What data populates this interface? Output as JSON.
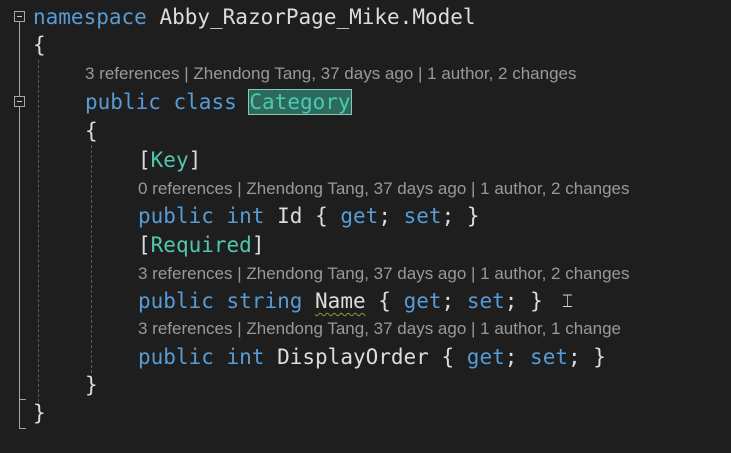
{
  "code": {
    "ns_keyword": "namespace",
    "ns_name": "Abby_RazorPage_Mike.Model",
    "open_brace_ns": "{",
    "close_brace_ns": "}",
    "class_modifier": "public",
    "class_keyword": "class",
    "class_name": "Category",
    "open_brace_class": "{",
    "close_brace_class": "}",
    "attr_key_open": "[",
    "attr_key": "Key",
    "attr_key_close": "]",
    "attr_required_open": "[",
    "attr_required": "Required",
    "attr_required_close": "]",
    "prop_id": {
      "modifier": "public",
      "type": "int",
      "name": "Id",
      "open": "{",
      "get": "get",
      "semi1": ";",
      "set": "set",
      "semi2": ";",
      "close": "}"
    },
    "prop_name": {
      "modifier": "public",
      "type": "string",
      "name": "Name",
      "open": "{",
      "get": "get",
      "semi1": ";",
      "set": "set",
      "semi2": ";",
      "close": "}"
    },
    "prop_display": {
      "modifier": "public",
      "type": "int",
      "name": "DisplayOrder",
      "open": "{",
      "get": "get",
      "semi1": ";",
      "set": "set",
      "semi2": ";",
      "close": "}"
    }
  },
  "codelens": {
    "class": "3 references | Zhendong Tang, 37 days ago | 1 author, 2 changes",
    "id": "0 references | Zhendong Tang, 37 days ago | 1 author, 2 changes",
    "name": "3 references | Zhendong Tang, 37 days ago | 1 author, 2 changes",
    "display_order": "3 references | Zhendong Tang, 37 days ago | 1 author, 1 change"
  },
  "icons": {
    "collapse": "collapse-icon",
    "cursor": "text-cursor-icon"
  },
  "colors": {
    "background": "#1e1e1e",
    "keyword": "#569cd6",
    "type": "#4ec9b0",
    "plain": "#dcdcdc",
    "codelens": "#999999",
    "highlight": "#2b6a5d"
  }
}
